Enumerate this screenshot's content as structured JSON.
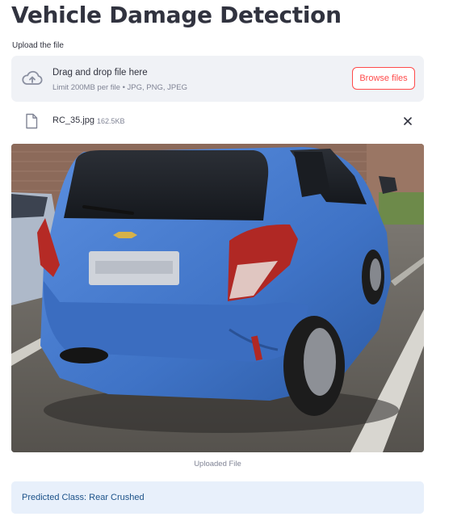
{
  "page": {
    "title": "Vehicle Damage Detection"
  },
  "uploader": {
    "label": "Upload the file",
    "instruction": "Drag and drop file here",
    "limits": "Limit 200MB per file • JPG, PNG, JPEG",
    "browse_label": "Browse files",
    "icon": "cloud-upload-icon"
  },
  "uploaded_file": {
    "name": "RC_35.jpg",
    "size": "162.5KB",
    "icon": "file-icon",
    "remove_icon": "close-icon"
  },
  "image": {
    "caption": "Uploaded File",
    "subject": "blue hatchback with crushed rear bumper"
  },
  "result": {
    "text": "Predicted Class: Rear Crushed"
  },
  "colors": {
    "accent": "#ff4b4b",
    "dropzone_bg": "#f0f2f6",
    "info_bg": "#e8f0fb",
    "info_text": "#1c5289",
    "car_body": "#4a7fd1"
  }
}
